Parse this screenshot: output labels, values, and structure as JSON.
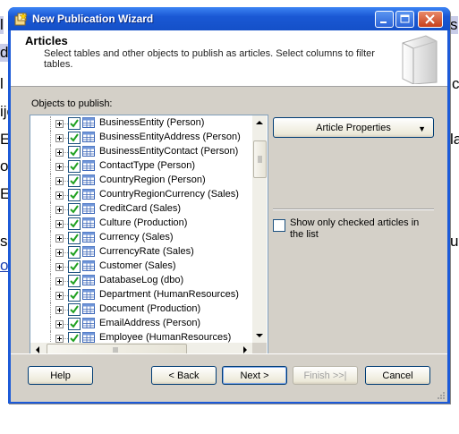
{
  "background_fragments": [
    "l",
    "de",
    "l",
    "ije",
    "E",
    "o",
    "E",
    "s",
    "or",
    "s",
    "c",
    "la",
    "ur"
  ],
  "window": {
    "title": "New Publication Wizard"
  },
  "header": {
    "title": "Articles",
    "description": "Select tables and other objects to publish as articles. Select columns to filter tables."
  },
  "objects": {
    "label": "Objects to publish:",
    "items": [
      {
        "label": "BusinessEntity (Person)",
        "checked": true
      },
      {
        "label": "BusinessEntityAddress (Person)",
        "checked": true
      },
      {
        "label": "BusinessEntityContact (Person)",
        "checked": true
      },
      {
        "label": "ContactType (Person)",
        "checked": true
      },
      {
        "label": "CountryRegion (Person)",
        "checked": true
      },
      {
        "label": "CountryRegionCurrency (Sales)",
        "checked": true
      },
      {
        "label": "CreditCard (Sales)",
        "checked": true
      },
      {
        "label": "Culture (Production)",
        "checked": true
      },
      {
        "label": "Currency (Sales)",
        "checked": true
      },
      {
        "label": "CurrencyRate (Sales)",
        "checked": true
      },
      {
        "label": "Customer (Sales)",
        "checked": true
      },
      {
        "label": "DatabaseLog (dbo)",
        "checked": true
      },
      {
        "label": "Department (HumanResources)",
        "checked": true
      },
      {
        "label": "Document (Production)",
        "checked": true
      },
      {
        "label": "EmailAddress (Person)",
        "checked": true
      },
      {
        "label": "Employee (HumanResources)",
        "checked": true
      }
    ]
  },
  "article_properties_label": "Article Properties",
  "show_only_checked": {
    "label": "Show only checked articles in the list",
    "checked": false
  },
  "footer": {
    "help": "Help",
    "back": "< Back",
    "next": "Next >",
    "finish": "Finish >>|",
    "cancel": "Cancel"
  },
  "colors": {
    "titlebar": "#1a58d4",
    "dialog_face": "#d4d0c8",
    "check": "#21a121"
  },
  "icons": [
    "wizard-app-icon",
    "minimize-icon",
    "maximize-icon",
    "close-icon",
    "tree-expand-icon",
    "table-icon",
    "dropdown-caret-icon",
    "scroll-up-icon",
    "scroll-down-icon",
    "scroll-left-icon",
    "scroll-right-icon",
    "resize-grip-icon"
  ]
}
